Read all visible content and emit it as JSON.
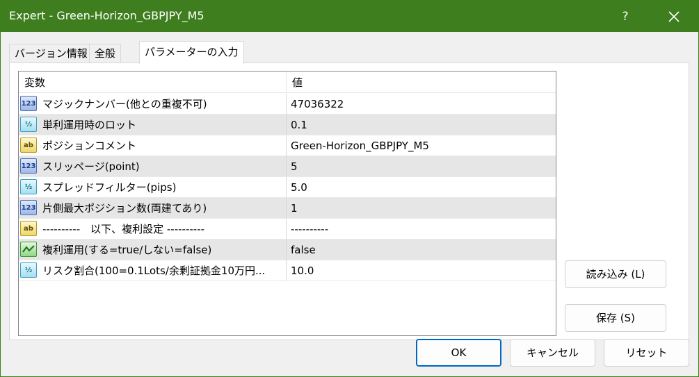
{
  "window": {
    "title": "Expert - Green-Horizon_GBPJPY_M5",
    "help_label": "?"
  },
  "tabs": [
    {
      "label": "バージョン情報"
    },
    {
      "label": "全般"
    },
    {
      "label": "パラメーターの入力"
    }
  ],
  "grid": {
    "headers": {
      "name": "変数",
      "value": "値"
    },
    "rows": [
      {
        "icon": "int-type-icon",
        "icon_text": "123",
        "name": "マジックナンバー(他との重複不可)",
        "value": "47036322"
      },
      {
        "icon": "double-type-icon",
        "icon_text": "½",
        "name": "単利運用時のロット",
        "value": "0.1"
      },
      {
        "icon": "string-type-icon",
        "icon_text": "ab",
        "name": "ポジションコメント",
        "value": "Green-Horizon_GBPJPY_M5"
      },
      {
        "icon": "int-type-icon",
        "icon_text": "123",
        "name": "スリッページ(point)",
        "value": "5"
      },
      {
        "icon": "double-type-icon",
        "icon_text": "½",
        "name": "スプレッドフィルター(pips)",
        "value": "5.0"
      },
      {
        "icon": "int-type-icon",
        "icon_text": "123",
        "name": "片側最大ポジション数(両建てあり)",
        "value": "1"
      },
      {
        "icon": "string-type-icon",
        "icon_text": "ab",
        "name": "----------　以下、複利設定 ----------",
        "value": "----------"
      },
      {
        "icon": "bool-type-icon",
        "icon_text": "",
        "name": "複利運用(する=true/しない=false)",
        "value": "false"
      },
      {
        "icon": "double-type-icon",
        "icon_text": "½",
        "name": "リスク割合(100=0.1Lots/余剰証拠金10万円...",
        "value": "10.0"
      }
    ]
  },
  "buttons": {
    "load": "読み込み (L)",
    "save": "保存 (S)",
    "ok": "OK",
    "cancel": "キャンセル",
    "reset": "リセット"
  },
  "colors": {
    "titlebar": "#3e7e1e",
    "row_alt": "#e6e6e6",
    "primary_border": "#0067c0"
  }
}
